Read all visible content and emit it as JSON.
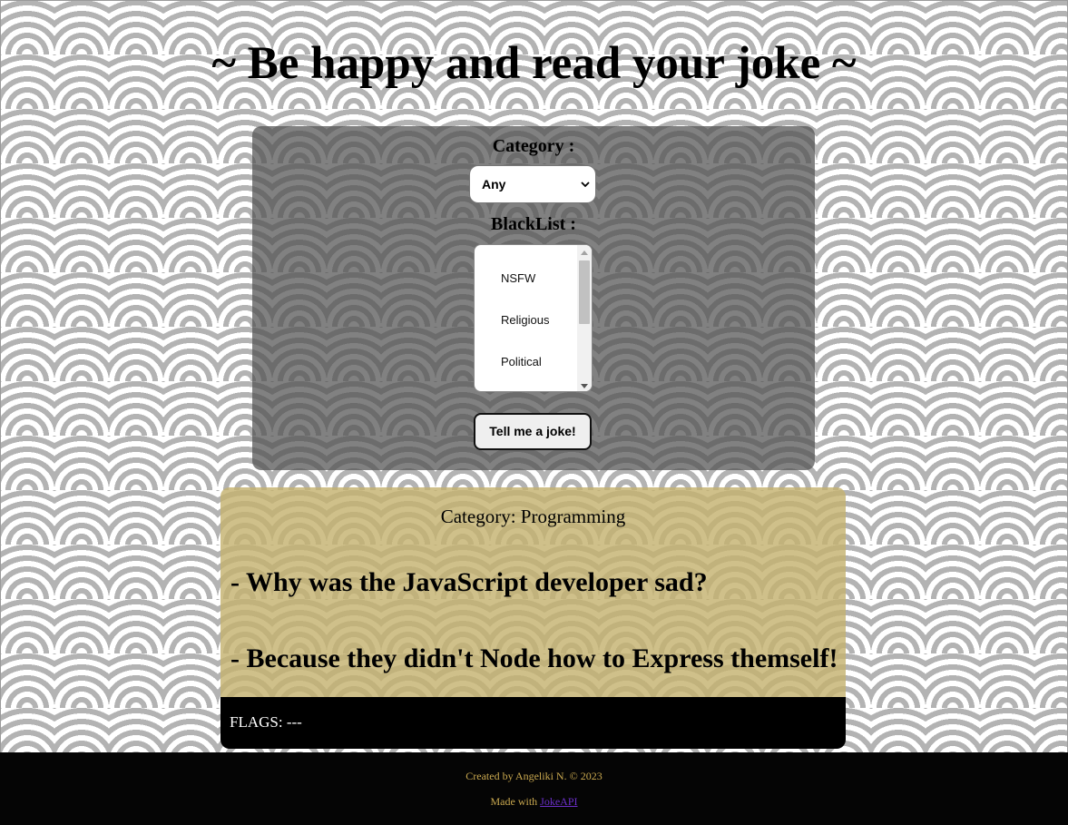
{
  "title": "~ Be happy and read your joke ~",
  "controls": {
    "category_label": "Category :",
    "category_value": "Any",
    "blacklist_label": "BlackList :",
    "blacklist_options": [
      "NSFW",
      "Religious",
      "Political"
    ],
    "button_label": "Tell me a joke!"
  },
  "joke": {
    "category": "Category: Programming",
    "setup": "- Why was the JavaScript developer sad?",
    "delivery": "- Because they didn't Node how to Express themself!",
    "flags": "FLAGS: ---"
  },
  "footer": {
    "credit": "Created by Angeliki N. © 2023",
    "made_with": "Made with",
    "link_text": "JokeAPI"
  },
  "colors": {
    "panel": "#505050",
    "card": "#c4b270",
    "footer_text": "#c9a84f",
    "link": "#6b2fc9"
  }
}
